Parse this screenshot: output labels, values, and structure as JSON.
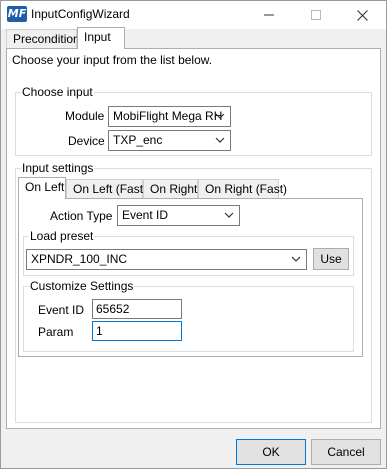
{
  "window": {
    "title": "InputConfigWizard",
    "icon_text": "MF"
  },
  "tabs": [
    {
      "label": "Precondition"
    },
    {
      "label": "Input",
      "active": true
    }
  ],
  "instruction": "Choose your input from the list below.",
  "choose_input": {
    "legend": "Choose input",
    "module_label": "Module",
    "module_value": "MobiFlight Mega RH",
    "device_label": "Device",
    "device_value": "TXP_enc"
  },
  "input_settings": {
    "legend": "Input settings",
    "tabs": [
      {
        "label": "On Left",
        "active": true
      },
      {
        "label": "On Left (Fast)"
      },
      {
        "label": "On Right"
      },
      {
        "label": "On Right (Fast)"
      }
    ],
    "action_type_label": "Action Type",
    "action_type_value": "Event ID",
    "load_preset": {
      "legend": "Load preset",
      "value": "XPNDR_100_INC",
      "use_label": "Use"
    },
    "customize": {
      "legend": "Customize Settings",
      "event_id_label": "Event ID",
      "event_id_value": "65652",
      "param_label": "Param",
      "param_value": "1"
    }
  },
  "footer": {
    "ok_label": "OK",
    "cancel_label": "Cancel"
  },
  "colors": {
    "accent_border": "#0078d7",
    "groupbox_border": "#d5dfe5",
    "window_bg": "#f0f0f0"
  }
}
